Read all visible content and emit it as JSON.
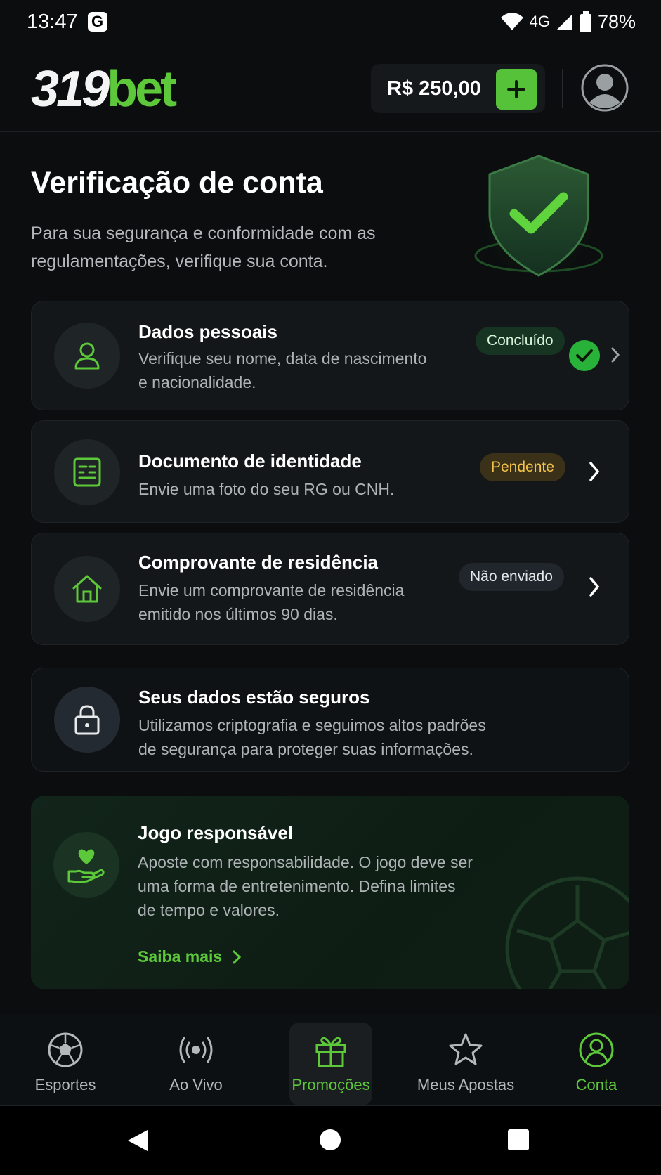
{
  "status_bar": {
    "time": "13:47",
    "g_badge": "G",
    "network": "4G",
    "battery": "78%"
  },
  "header": {
    "logo_num": "319",
    "logo_bet": "bet",
    "balance": "R$ 250,00"
  },
  "hero": {
    "title": "Verificação de conta",
    "subtitle": "Para sua segurança e conformidade com as regulamentações, verifique sua conta."
  },
  "verification_items": [
    {
      "title": "Dados pessoais",
      "description": "Verifique seu nome, data de nascimento e nacionalidade.",
      "status": "Concluído",
      "icon": "user-icon"
    },
    {
      "title": "Documento de identidade",
      "description": "Envie uma foto do seu RG ou CNH.",
      "status": "Pendente",
      "icon": "id-card-icon"
    },
    {
      "title": "Comprovante de residência",
      "description": "Envie um comprovante de residência emitido nos últimos 90 dias.",
      "status": "Não enviado",
      "icon": "house-icon"
    }
  ],
  "security_card": {
    "title": "Seus dados estão seguros",
    "description": "Utilizamos criptografia e seguimos altos padrões de segurança para proteger suas informações.",
    "icon": "lock-icon"
  },
  "responsible_card": {
    "title": "Jogo responsável",
    "description": "Aposte com responsabilidade. O jogo deve ser uma forma de entretenimento. Defina limites de tempo e valores.",
    "link": "Saiba mais",
    "icon": "heart-hand-icon"
  },
  "bottom_nav": [
    {
      "label": "Esportes",
      "icon": "soccer-ball-icon"
    },
    {
      "label": "Ao Vivo",
      "icon": "live-broadcast-icon"
    },
    {
      "label": "Promoções",
      "icon": "gift-icon"
    },
    {
      "label": "Meus Apostas",
      "icon": "star-icon"
    },
    {
      "label": "Conta",
      "icon": "account-icon"
    }
  ],
  "colors": {
    "accent": "#5cc83a",
    "background": "#0b0d0e",
    "card": "#141719",
    "pending": "#f2c24a"
  }
}
